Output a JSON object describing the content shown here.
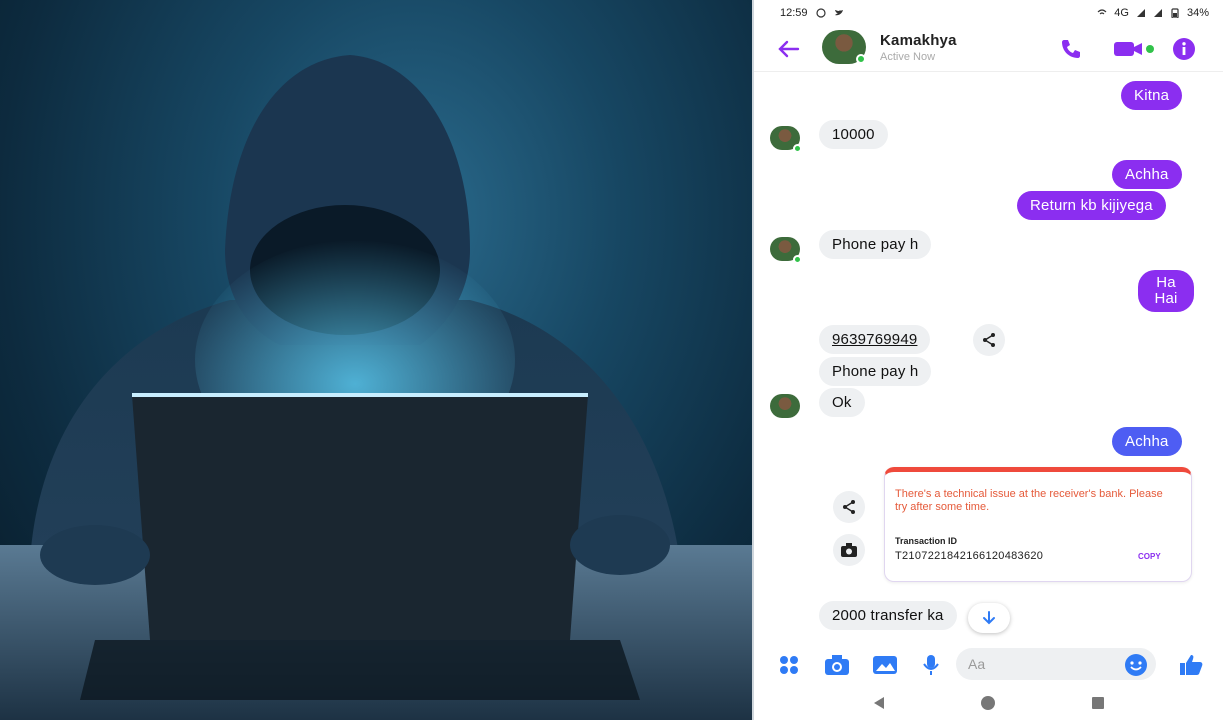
{
  "status_bar": {
    "time": "12:59",
    "network": "4G",
    "battery": "34%"
  },
  "header": {
    "contact_name": "Kamakhya",
    "contact_status": "Active Now"
  },
  "messages": [
    {
      "direction": "out",
      "text": "Kitna"
    },
    {
      "direction": "in",
      "text": "10000"
    },
    {
      "direction": "out",
      "text": "Achha"
    },
    {
      "direction": "out",
      "text": "Return kb kijiyega"
    },
    {
      "direction": "in",
      "text": "Phone pay h"
    },
    {
      "direction": "out",
      "text": "Ha Hai"
    },
    {
      "direction": "in",
      "text": "9639769949"
    },
    {
      "direction": "in",
      "text": "Phone pay h"
    },
    {
      "direction": "in",
      "text": "Ok"
    },
    {
      "direction": "out",
      "text": "Achha"
    },
    {
      "direction": "in",
      "text": "2000 transfer ka"
    }
  ],
  "transaction_card": {
    "error_text": "There's a technical issue at the receiver's bank. Please try after some time.",
    "id_label": "Transaction ID",
    "transaction_id": "T2107221842166120483620",
    "copy_label": "COPY"
  },
  "composer": {
    "placeholder": "Aa"
  },
  "colors": {
    "accent_purple": "#8b2ef0",
    "accent_blue": "#4e5df3",
    "error_red": "#ef4a3c",
    "online_green": "#31c24a"
  }
}
